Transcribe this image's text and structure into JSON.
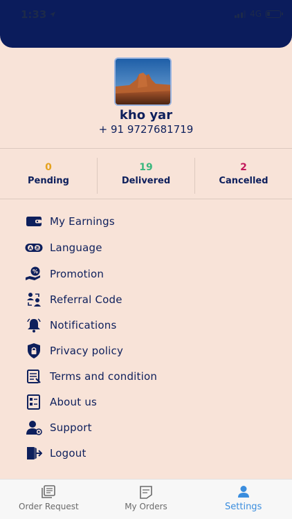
{
  "status_bar": {
    "time": "1:33",
    "network": "4G"
  },
  "profile": {
    "name": "kho yar",
    "phone": "+ 91 9727681719"
  },
  "stats": [
    {
      "value": "0",
      "label": "Pending",
      "color": "#e5a21f"
    },
    {
      "value": "19",
      "label": "Delivered",
      "color": "#3bb77e"
    },
    {
      "value": "2",
      "label": "Cancelled",
      "color": "#c2185b"
    }
  ],
  "menu": [
    {
      "label": "My Earnings",
      "icon": "wallet-icon"
    },
    {
      "label": "Language",
      "icon": "language-icon"
    },
    {
      "label": "Promotion",
      "icon": "promotion-icon"
    },
    {
      "label": "Referral Code",
      "icon": "referral-icon"
    },
    {
      "label": "Notifications",
      "icon": "bell-icon"
    },
    {
      "label": "Privacy policy",
      "icon": "shield-lock-icon"
    },
    {
      "label": "Terms and condition",
      "icon": "document-icon"
    },
    {
      "label": "About us",
      "icon": "info-list-icon"
    },
    {
      "label": "Support",
      "icon": "support-icon"
    },
    {
      "label": "Logout",
      "icon": "logout-icon"
    }
  ],
  "tabs": [
    {
      "label": "Order Request",
      "icon": "orders-stack-icon",
      "active": false
    },
    {
      "label": "My Orders",
      "icon": "order-note-icon",
      "active": false
    },
    {
      "label": "Settings",
      "icon": "person-icon",
      "active": true
    }
  ],
  "colors": {
    "header": "#0b1c5c",
    "background": "#f8e3d8",
    "text": "#0d1f5c",
    "active_tab": "#3a8dde"
  }
}
